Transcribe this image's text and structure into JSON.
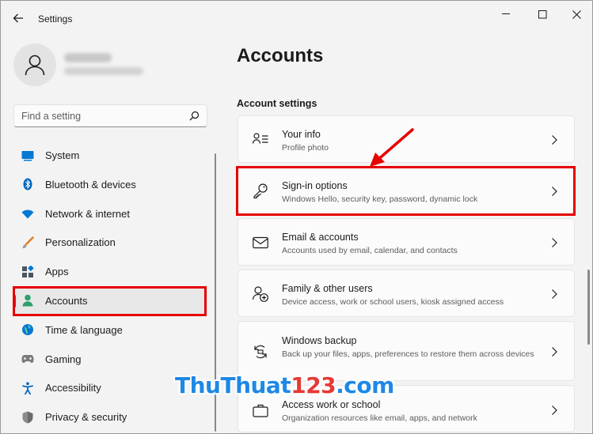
{
  "window": {
    "title": "Settings"
  },
  "profile": {
    "avatar_icon": "person-icon"
  },
  "search": {
    "placeholder": "Find a setting",
    "value": ""
  },
  "nav": {
    "items": [
      {
        "label": "System",
        "icon": "system-icon",
        "color": "#0078d4"
      },
      {
        "label": "Bluetooth & devices",
        "icon": "bluetooth-icon",
        "color": "#0067c0"
      },
      {
        "label": "Network & internet",
        "icon": "wifi-icon",
        "color": "#0078d4"
      },
      {
        "label": "Personalization",
        "icon": "brush-icon",
        "color": "#e07a20"
      },
      {
        "label": "Apps",
        "icon": "apps-icon",
        "color": "#4a5560"
      },
      {
        "label": "Accounts",
        "icon": "account-icon",
        "color": "#2ea06c",
        "selected": true
      },
      {
        "label": "Time & language",
        "icon": "globe-icon",
        "color": "#0078d4"
      },
      {
        "label": "Gaming",
        "icon": "gamepad-icon",
        "color": "#7a7a7a"
      },
      {
        "label": "Accessibility",
        "icon": "accessibility-icon",
        "color": "#0067c0"
      },
      {
        "label": "Privacy & security",
        "icon": "shield-icon",
        "color": "#6b6b6b"
      }
    ]
  },
  "main": {
    "page_title": "Accounts",
    "section_title": "Account settings",
    "cards": [
      {
        "title": "Your info",
        "desc": "Profile photo",
        "icon": "user-info-icon"
      },
      {
        "title": "Sign-in options",
        "desc": "Windows Hello, security key, password, dynamic lock",
        "icon": "key-icon"
      },
      {
        "title": "Email & accounts",
        "desc": "Accounts used by email, calendar, and contacts",
        "icon": "mail-icon"
      },
      {
        "title": "Family & other users",
        "desc": "Device access, work or school users, kiosk assigned access",
        "icon": "add-user-icon"
      },
      {
        "title": "Windows backup",
        "desc": "Back up your files, apps, preferences to restore them across devices",
        "icon": "backup-icon"
      },
      {
        "title": "Access work or school",
        "desc": "Organization resources like email, apps, and network",
        "icon": "briefcase-icon"
      }
    ]
  },
  "watermark": {
    "part1": "ThuThuat",
    "part2": "123",
    "part3": ".com"
  },
  "colors": {
    "accent": "#0067c0",
    "annotation_red": "#e60000"
  }
}
